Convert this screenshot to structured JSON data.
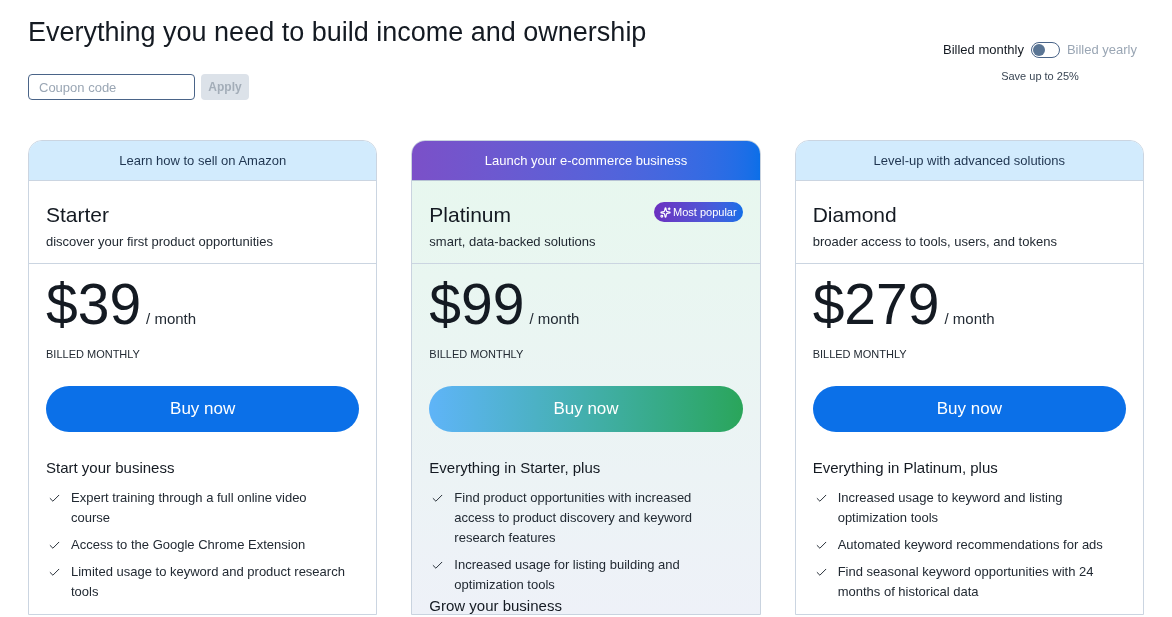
{
  "heading": "Everything you need to build income and ownership",
  "coupon": {
    "placeholder": "Coupon code",
    "apply_label": "Apply",
    "apply_disabled": true
  },
  "billing": {
    "monthly_label": "Billed monthly",
    "yearly_label": "Billed yearly",
    "yearly": false,
    "savings_note": "Save up to 25%"
  },
  "plans": [
    {
      "tagline": "Learn how to sell on Amazon",
      "featured": false,
      "name": "Starter",
      "description": "discover your first product opportunities",
      "price": "$39",
      "period": "/ month",
      "billing_note": "BILLED MONTHLY",
      "button_label": "Buy now",
      "feature_groups": [
        {
          "heading": "Start your business",
          "features": [
            "Expert training through a full online video course",
            "Access to the Google Chrome Extension",
            "Limited usage to keyword and product research tools"
          ]
        }
      ]
    },
    {
      "tagline": "Launch your e-commerce business",
      "featured": true,
      "name": "Platinum",
      "badge": "Most popular",
      "description": "smart, data-backed solutions",
      "price": "$99",
      "period": "/ month",
      "billing_note": "BILLED MONTHLY",
      "button_label": "Buy now",
      "feature_groups": [
        {
          "heading": "Everything in Starter, plus",
          "features": [
            "Find product opportunities with increased access to product discovery and keyword research features",
            "Increased usage for listing building and optimization tools"
          ]
        },
        {
          "heading": "Grow your business"
        }
      ]
    },
    {
      "tagline": "Level-up with advanced solutions",
      "featured": false,
      "name": "Diamond",
      "description": "broader access to tools, users, and tokens",
      "price": "$279",
      "period": "/ month",
      "billing_note": "BILLED MONTHLY",
      "button_label": "Buy now",
      "feature_groups": [
        {
          "heading": "Everything in Platinum, plus",
          "features": [
            "Increased usage to keyword and listing optimization tools",
            "Automated keyword recommendations for ads",
            "Find seasonal keyword opportunities with 24 months of historical data"
          ]
        }
      ]
    }
  ]
}
